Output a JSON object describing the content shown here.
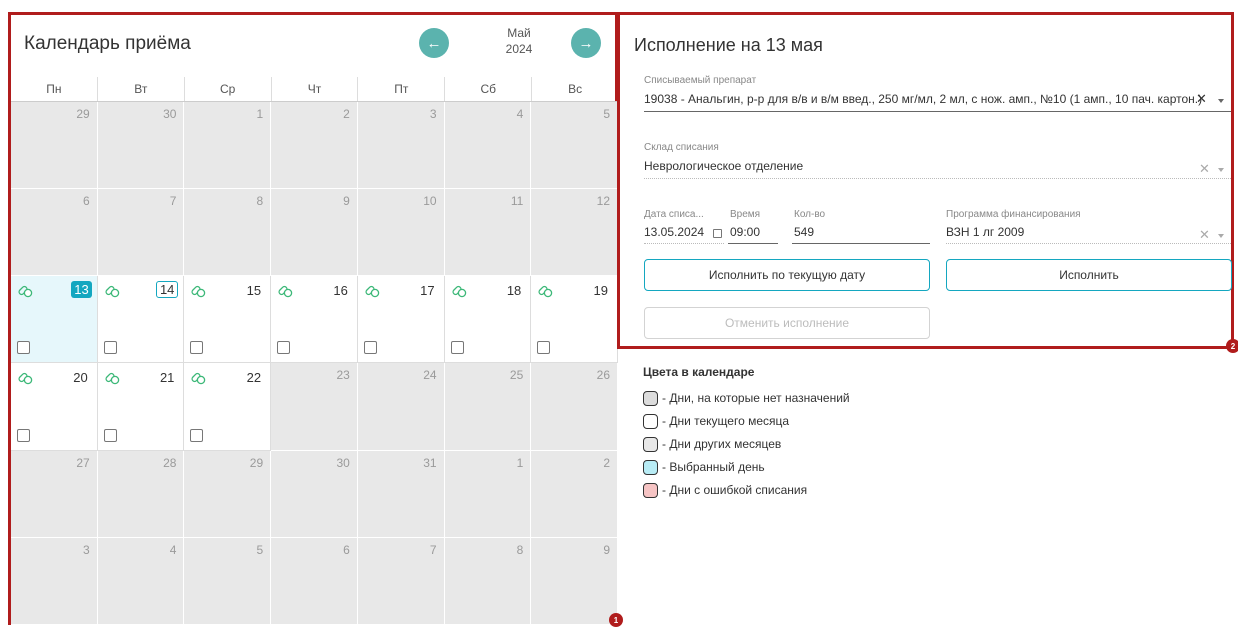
{
  "calendar": {
    "title": "Календарь приёма",
    "month": "Май",
    "year": "2024",
    "prev_icon": "arrow-left-icon",
    "next_icon": "arrow-right-icon",
    "weekdays": [
      "Пн",
      "Вт",
      "Ср",
      "Чт",
      "Пт",
      "Сб",
      "Вс"
    ],
    "days": [
      {
        "n": "29",
        "t": "other"
      },
      {
        "n": "30",
        "t": "other"
      },
      {
        "n": "1",
        "t": "other"
      },
      {
        "n": "2",
        "t": "other"
      },
      {
        "n": "3",
        "t": "other"
      },
      {
        "n": "4",
        "t": "other"
      },
      {
        "n": "5",
        "t": "other"
      },
      {
        "n": "6",
        "t": "other"
      },
      {
        "n": "7",
        "t": "other"
      },
      {
        "n": "8",
        "t": "other"
      },
      {
        "n": "9",
        "t": "other"
      },
      {
        "n": "10",
        "t": "other"
      },
      {
        "n": "11",
        "t": "other"
      },
      {
        "n": "12",
        "t": "other"
      },
      {
        "n": "13",
        "t": "selected",
        "pill": true,
        "check": true,
        "today": true
      },
      {
        "n": "14",
        "t": "current",
        "pill": true,
        "check": true,
        "outlined": true
      },
      {
        "n": "15",
        "t": "current",
        "pill": true,
        "check": true
      },
      {
        "n": "16",
        "t": "current",
        "pill": true,
        "check": true
      },
      {
        "n": "17",
        "t": "current",
        "pill": true,
        "check": true
      },
      {
        "n": "18",
        "t": "current",
        "pill": true,
        "check": true
      },
      {
        "n": "19",
        "t": "current",
        "pill": true,
        "check": true
      },
      {
        "n": "20",
        "t": "current",
        "pill": true,
        "check": true
      },
      {
        "n": "21",
        "t": "current",
        "pill": true,
        "check": true
      },
      {
        "n": "22",
        "t": "current",
        "pill": true,
        "check": true
      },
      {
        "n": "23",
        "t": "other"
      },
      {
        "n": "24",
        "t": "other"
      },
      {
        "n": "25",
        "t": "other"
      },
      {
        "n": "26",
        "t": "other"
      },
      {
        "n": "27",
        "t": "other"
      },
      {
        "n": "28",
        "t": "other"
      },
      {
        "n": "29",
        "t": "other"
      },
      {
        "n": "30",
        "t": "other"
      },
      {
        "n": "31",
        "t": "other"
      },
      {
        "n": "1",
        "t": "other"
      },
      {
        "n": "2",
        "t": "other"
      },
      {
        "n": "3",
        "t": "other"
      },
      {
        "n": "4",
        "t": "other"
      },
      {
        "n": "5",
        "t": "other"
      },
      {
        "n": "6",
        "t": "other"
      },
      {
        "n": "7",
        "t": "other"
      },
      {
        "n": "8",
        "t": "other"
      },
      {
        "n": "9",
        "t": "other"
      }
    ],
    "badge": "1"
  },
  "execution": {
    "title": "Исполнение на 13 мая",
    "drug_label": "Списываемый препарат",
    "drug_value": "19038 - Анальгин, р-р для в/в и в/м введ., 250 мг/мл, 2 мл, с нож. амп., №10 (1 амп., 10 пач. картон.)",
    "warehouse_label": "Склад списания",
    "warehouse_value": "Неврологическое отделение",
    "date_label": "Дата списа...",
    "date_value": "13.05.2024",
    "time_label": "Время",
    "time_value": "09:00",
    "qty_label": "Кол-во",
    "qty_value": "549",
    "program_label": "Программа финансирования",
    "program_value": "ВЗН 1 лг 2009",
    "btn_execute_current": "Исполнить по текущую дату",
    "btn_execute": "Исполнить",
    "btn_cancel": "Отменить исполнение",
    "badge": "2"
  },
  "legend": {
    "title": "Цвета в календаре",
    "items": [
      {
        "label": "- Дни, на которые нет назначений",
        "color": "#dcdcdc"
      },
      {
        "label": "- Дни текущего месяца",
        "color": "#ffffff"
      },
      {
        "label": "- Дни других месяцев",
        "color": "#e8e8e8"
      },
      {
        "label": "- Выбранный день",
        "color": "#b8ecf5"
      },
      {
        "label": "- Дни с ошибкой списания",
        "color": "#f6c4c4"
      }
    ]
  },
  "colors": {
    "accent": "#14a7c0",
    "nav_button": "#5bb3ae",
    "highlight_border": "#b01c1c",
    "other_month_bg": "#e8e8e8",
    "selected_bg": "#e6f7fb",
    "pill_icon": "#3cb878"
  }
}
